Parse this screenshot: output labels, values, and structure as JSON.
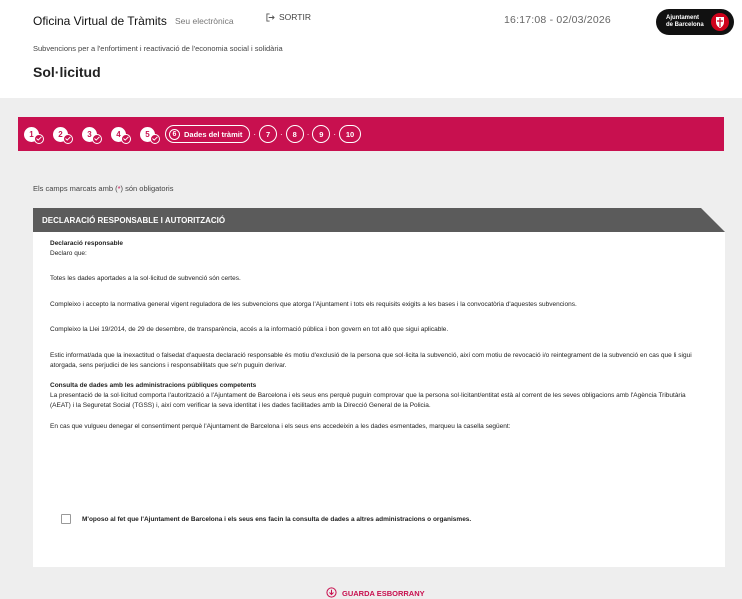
{
  "header": {
    "brand": "Oficina Virtual de Tràmits",
    "seu": "Seu electrònica",
    "sortir": "SORTIR",
    "clock": "16:17:08  - 02/03/2026",
    "logo_line1": "Ajuntament",
    "logo_line2": "de Barcelona",
    "subtitle": "Subvencions per a l'enfortiment i reactivació de l'economia social i solidària",
    "title": "Sol·licitud"
  },
  "steps": {
    "done": [
      "1",
      "2",
      "3",
      "4",
      "5"
    ],
    "current_number": "6",
    "current_label": "Dades del tràmit",
    "pending": [
      "7",
      "8",
      "9",
      "10"
    ],
    "separator": "·"
  },
  "form": {
    "required_prefix": "Els camps marcats amb (",
    "required_star": "*",
    "required_suffix": ") són obligatoris",
    "section_title": "DECLARACIÓ RESPONSABLE I AUTORITZACIÓ",
    "declaration_heading": "Declaració responsable",
    "declaration_intro": "Declaro que:",
    "paragraphs": [
      "Totes les dades aportades a la sol·licitud de subvenció són certes.",
      "Compleixo i accepto la normativa general vigent reguladora de les subvencions que atorga l'Ajuntament i tots els requisits exigits a les bases i la convocatòria d'aquestes subvencions.",
      "Compleixo la Llei 19/2014, de 29 de desembre, de transparència, accés a la informació pública i bon govern en tot allò que sigui aplicable.",
      "Estic informat/ada que la inexactitud o falsedat d'aquesta declaració responsable és motiu d'exclusió de la persona que sol·licita la subvenció, així com motiu de revocació i/o reintegrament de la subvenció en cas que li sigui atorgada, sens perjudici de les sancions i responsabilitats que se'n puguin derivar."
    ],
    "consult_heading": "Consulta de dades amb les administracions públiques competents",
    "consult_text": "La presentació de la sol·licitud comporta l'autorització a l'Ajuntament de Barcelona i els seus ens perquè puguin comprovar que la persona sol·licitant/entitat està al corrent de les seves obligacions amb l'Agència Tributària (AEAT) i la Seguretat Social (TGSS) i, així com verificar la seva identitat i les dades facilitades amb la Direcció General de la Policia.",
    "deny_text": "En cas que vulgueu denegar el consentiment perquè l'Ajuntament de Barcelona i els seus ens accedeixin a les dades esmentades, marqueu la casella següent:",
    "checkbox_label": "M'oposo al fet que l'Ajuntament de Barcelona i els seus ens facin la consulta de dades a altres administracions o organismes.",
    "save_label": "GUARDA ESBORRANY"
  }
}
